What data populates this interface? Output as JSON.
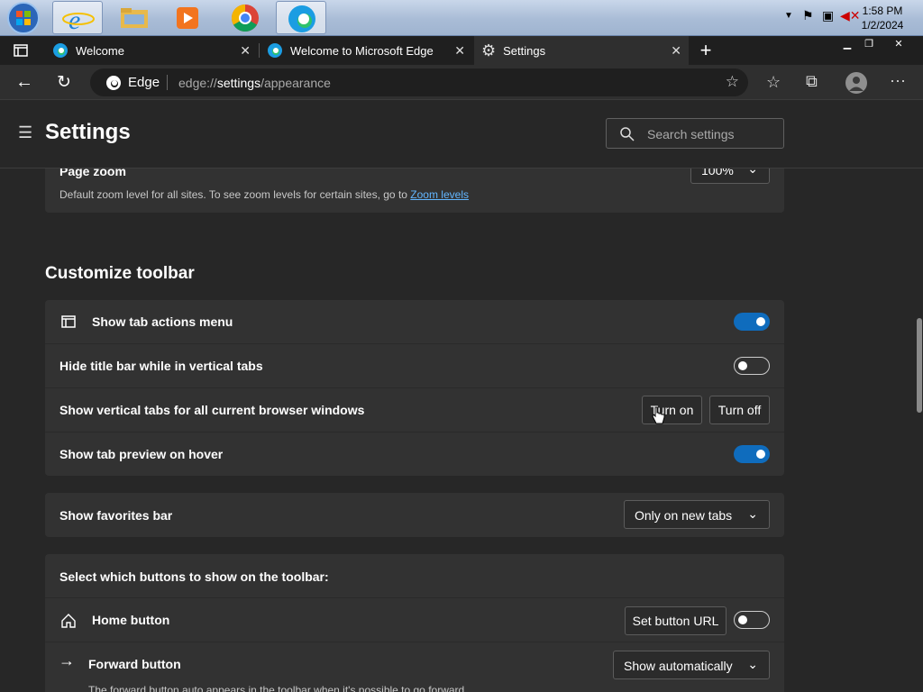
{
  "taskbar": {
    "apps": [
      "internet-explorer",
      "file-explorer",
      "media-player",
      "chrome",
      "edge"
    ],
    "clock": {
      "time": "1:58 PM",
      "date": "1/2/2024"
    }
  },
  "tabs": [
    {
      "title": "Welcome",
      "icon": "edge-icon"
    },
    {
      "title": "Welcome to Microsoft Edge",
      "icon": "edge-icon"
    },
    {
      "title": "Settings",
      "icon": "gear-icon"
    }
  ],
  "address": {
    "site_label": "Edge",
    "url_prefix": "edge://",
    "url_main": "settings",
    "url_suffix": "/appearance"
  },
  "header": {
    "title": "Settings",
    "search_placeholder": "Search settings"
  },
  "zoom": {
    "label": "Page zoom",
    "value": "100%",
    "desc": "Default zoom level for all sites. To see zoom levels for certain sites, go to ",
    "link": "Zoom levels"
  },
  "toolbar_section": {
    "heading": "Customize toolbar",
    "rows": [
      {
        "label": "Show tab actions menu",
        "state": "on"
      },
      {
        "label": "Hide title bar while in vertical tabs",
        "state": "off"
      },
      {
        "label": "Show vertical tabs for all current browser windows",
        "btn_on": "Turn on",
        "btn_off": "Turn off"
      },
      {
        "label": "Show tab preview on hover",
        "state": "on"
      }
    ]
  },
  "favorites": {
    "label": "Show favorites bar",
    "value": "Only on new tabs"
  },
  "buttons_section": {
    "heading": "Select which buttons to show on the toolbar:",
    "home": {
      "label": "Home button",
      "btn": "Set button URL",
      "state": "off"
    },
    "forward": {
      "label": "Forward button",
      "value": "Show automatically",
      "desc": "The forward button auto appears in the toolbar when it's possible to go forward"
    }
  },
  "colors": {
    "accent": "#0f6cbd",
    "bg": "#272727",
    "card": "#323232"
  }
}
